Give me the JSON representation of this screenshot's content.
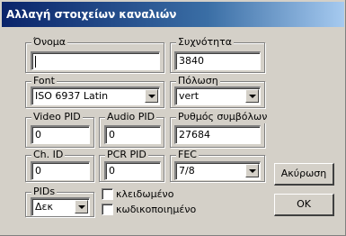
{
  "window": {
    "title": "Αλλαγή στοιχείων καναλιών"
  },
  "name": {
    "label": "Όνομα",
    "value": ""
  },
  "frequency": {
    "label": "Συχνότητα",
    "value": "3840"
  },
  "font": {
    "label": "Font",
    "value": "ISO 6937 Latin"
  },
  "polarization": {
    "label": "Πόλωση",
    "value": "vert"
  },
  "video_pid": {
    "label": "Video PID",
    "value": "0"
  },
  "audio_pid": {
    "label": "Audio PID",
    "value": "0"
  },
  "symbol_rate": {
    "label": "Ρυθμός συμβόλων",
    "value": "27684"
  },
  "ch_id": {
    "label": "Ch. ID",
    "value": "0"
  },
  "pcr_pid": {
    "label": "PCR PID",
    "value": "0"
  },
  "fec": {
    "label": "FEC",
    "value": "7/8"
  },
  "pids": {
    "label": "PIDs",
    "value": "Δεκ"
  },
  "locked": {
    "label": "κλειδωμένο",
    "checked": false
  },
  "encrypted": {
    "label": "κωδικοποιημένο",
    "checked": false
  },
  "buttons": {
    "cancel": "Ακύρωση",
    "ok": "OK"
  }
}
